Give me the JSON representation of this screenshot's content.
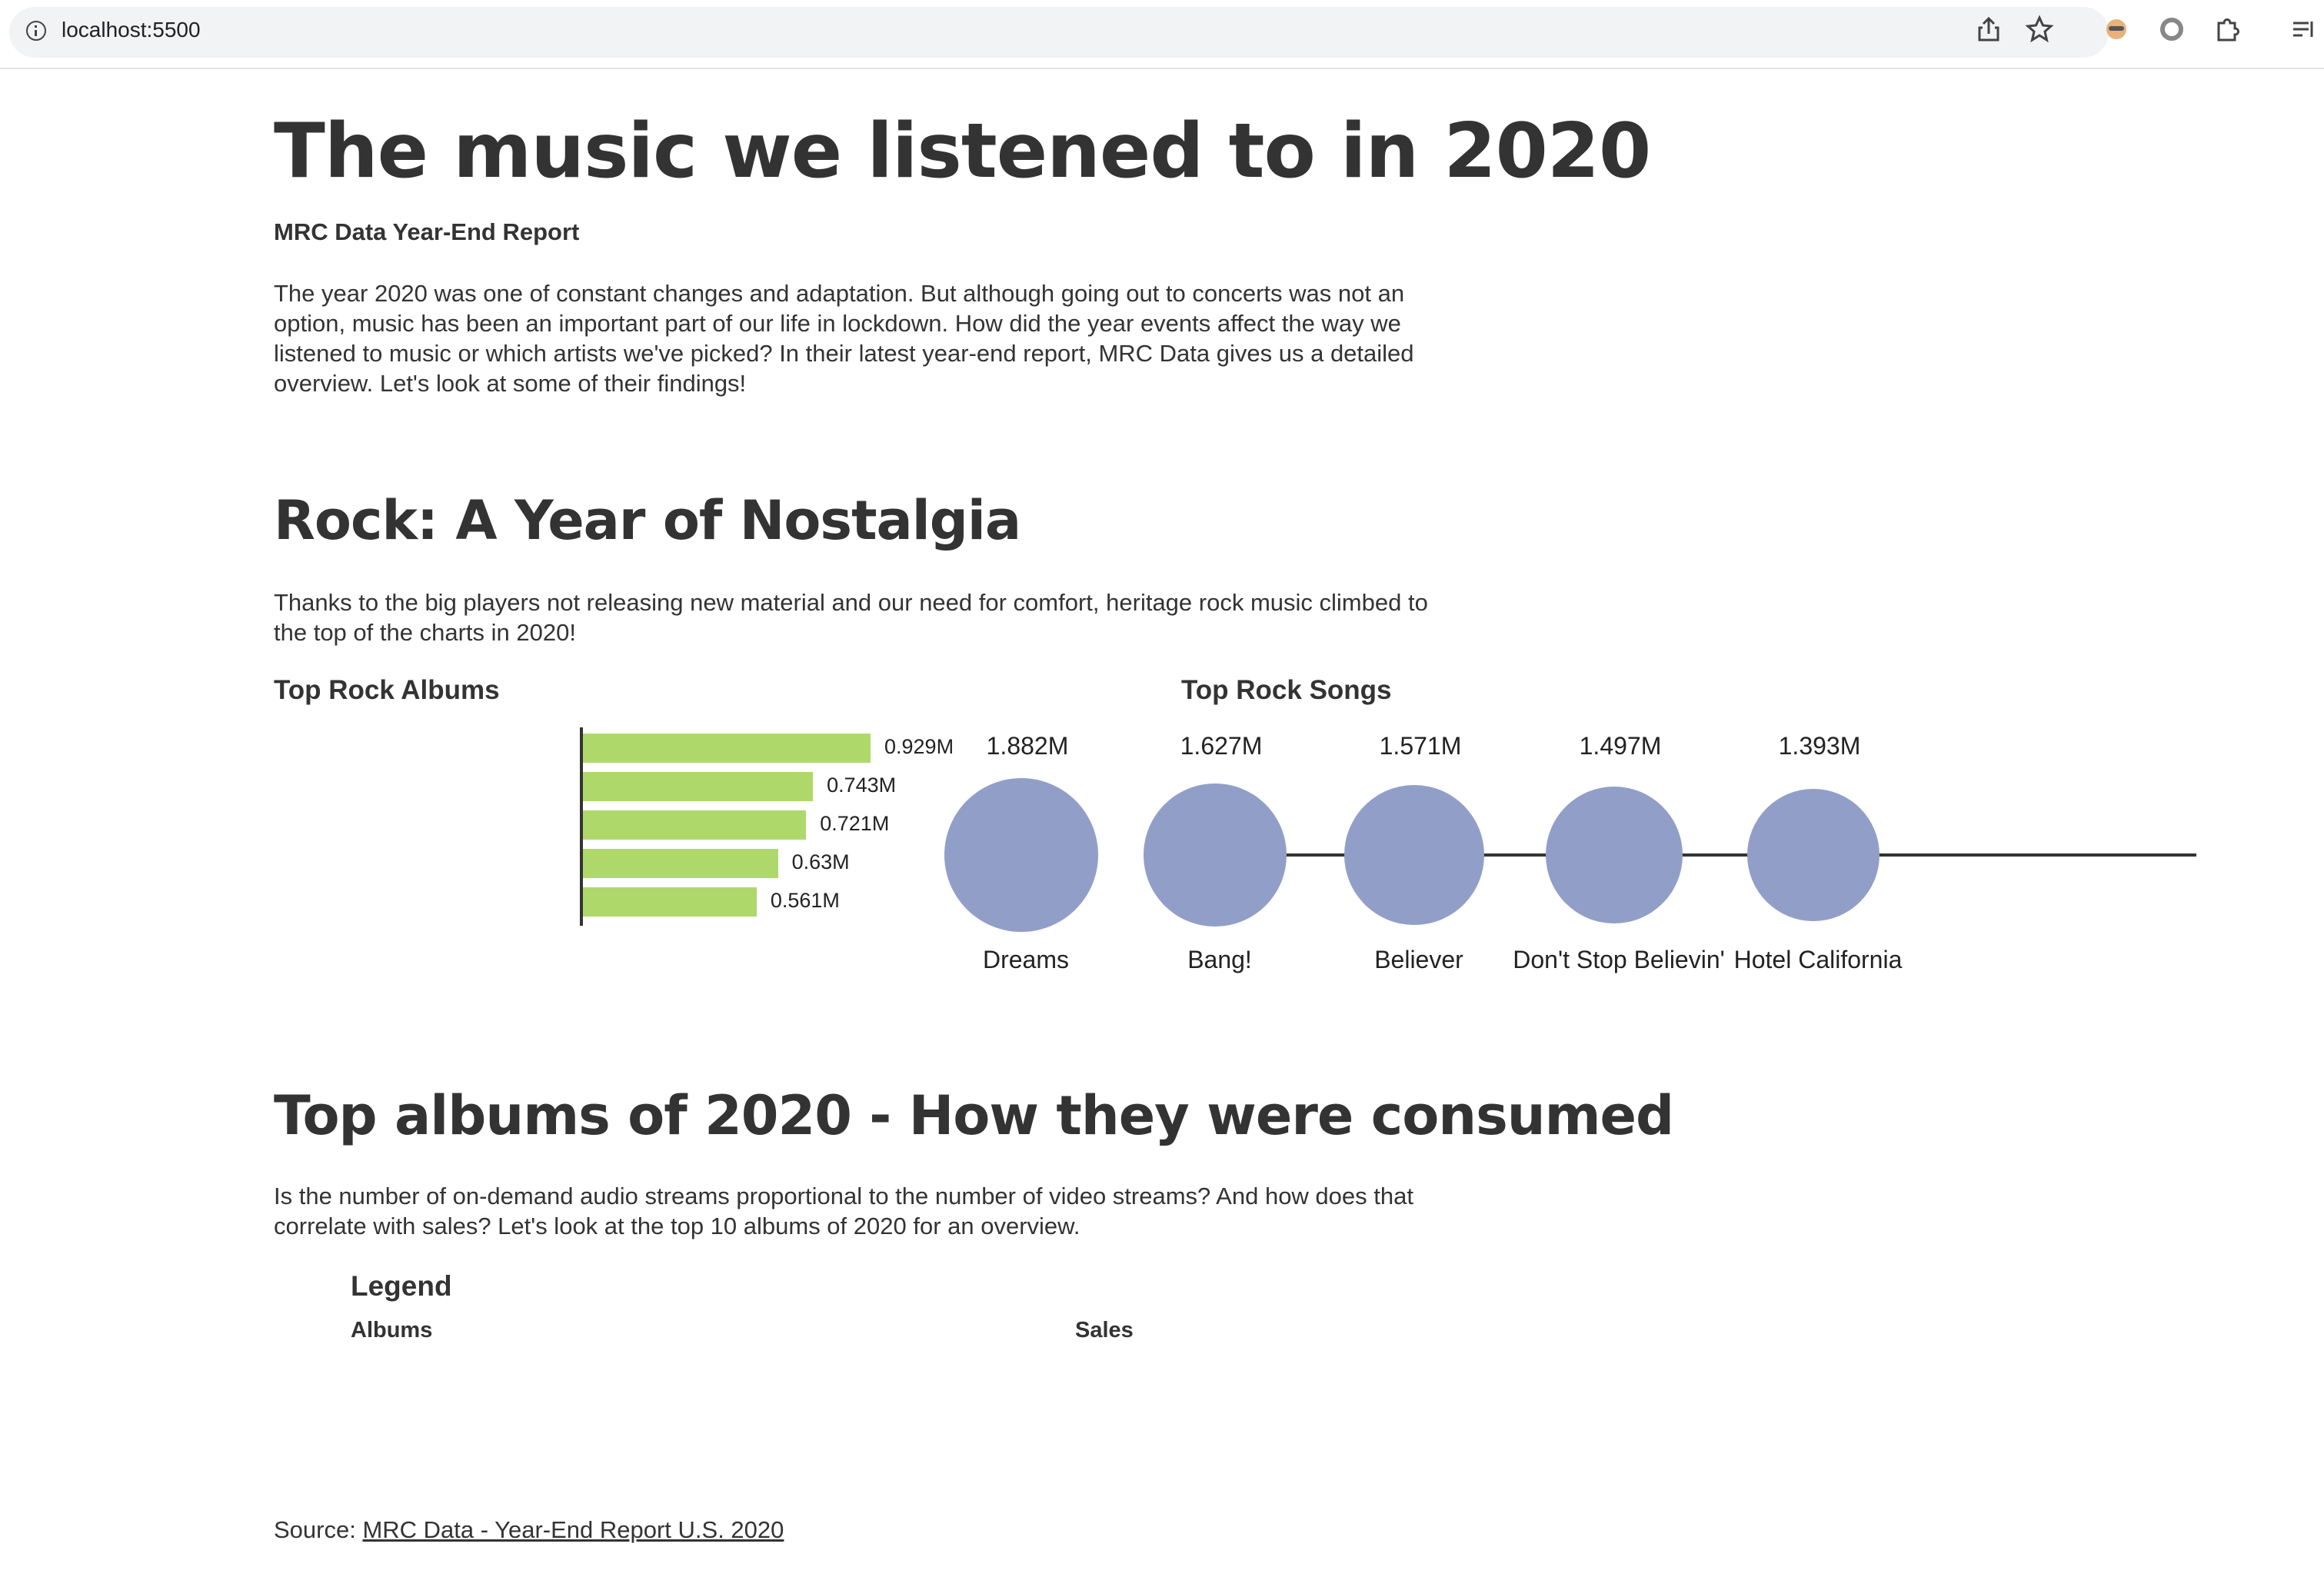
{
  "browser": {
    "url": "localhost:5500"
  },
  "article": {
    "title": "The music we listened to in 2020",
    "subtitle": "MRC Data Year-End Report",
    "intro": "The year 2020 was one of constant changes and adaptation. But although going out to concerts was not an option, music has been an important part of our life in lockdown. How did the year events affect the way we listened to music or which artists we've picked? In their latest year-end report, MRC Data gives us a detailed overview. Let's look at some of their findings!"
  },
  "rock_section": {
    "heading": "Rock: A Year of Nostalgia",
    "text": "Thanks to the big players not releasing new material and our need for comfort, heritage rock music climbed to the top of the charts in 2020!",
    "albums_title": "Top Rock Albums",
    "songs_title": "Top Rock Songs"
  },
  "albums_section": {
    "heading": "Top albums of 2020 - How they were consumed",
    "text": "Is the number of on-demand audio streams proportional to the number of video streams? And how does that correlate with sales? Let's look at the top 10 albums of 2020 for an overview.",
    "legend_title": "Legend",
    "legend_albums": "Albums",
    "legend_sales": "Sales"
  },
  "source": {
    "prefix": "Source: ",
    "link_text": "MRC Data - Year-End Report U.S. 2020"
  },
  "colors": {
    "bar": "#afd86b",
    "bubble": "#919fc8",
    "text": "#333333"
  },
  "chart_data": [
    {
      "type": "bar",
      "title": "Top Rock Albums",
      "orientation": "horizontal",
      "values": [
        0.929,
        0.743,
        0.721,
        0.63,
        0.561
      ],
      "value_labels": [
        "0.929M",
        "0.743M",
        "0.721M",
        "0.63M",
        "0.561M"
      ],
      "unit": "M"
    },
    {
      "type": "scatter",
      "title": "Top Rock Songs",
      "categories": [
        "Dreams",
        "Bang!",
        "Believer",
        "Don't Stop Believin'",
        "Hotel California"
      ],
      "values": [
        1.882,
        1.627,
        1.571,
        1.497,
        1.393
      ],
      "value_labels": [
        "1.882M",
        "1.627M",
        "1.571M",
        "1.497M",
        "1.393M"
      ],
      "unit": "M"
    }
  ]
}
